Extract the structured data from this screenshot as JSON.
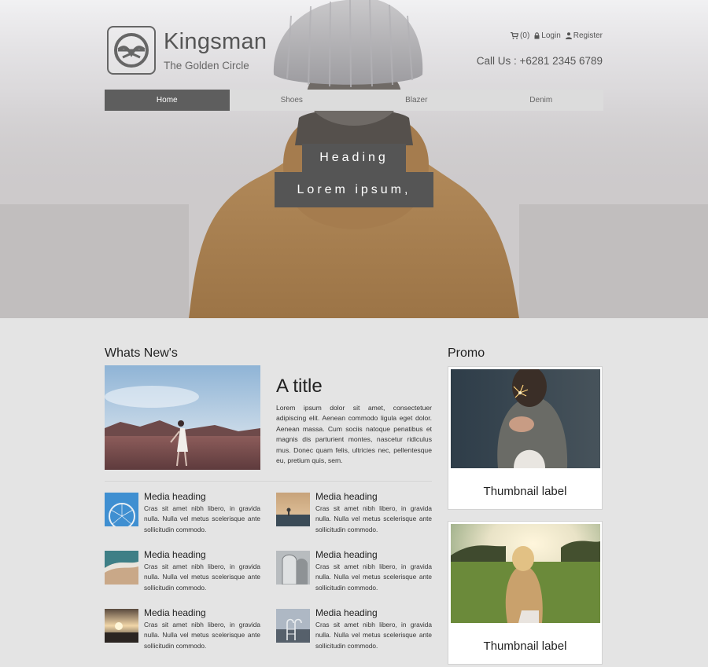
{
  "brand": {
    "title": "Kingsman",
    "subtitle": "The Golden Circle"
  },
  "top_links": {
    "cart": "(0)",
    "login": "Login",
    "register": "Register"
  },
  "contact": {
    "call": "Call Us : +6281 2345 6789"
  },
  "nav": {
    "items": [
      {
        "label": "Home",
        "active": true
      },
      {
        "label": "Shoes",
        "active": false
      },
      {
        "label": "Blazer",
        "active": false
      },
      {
        "label": "Denim",
        "active": false
      }
    ]
  },
  "hero": {
    "heading": "Heading",
    "text": "Lorem ipsum,"
  },
  "whats_new": {
    "title": "Whats New's",
    "feature": {
      "title": "A title",
      "body": "Lorem ipsum dolor sit amet, consectetuer adipiscing elit. Aenean commodo ligula eget dolor. Aenean massa. Cum sociis natoque penatibus et magnis dis parturient montes, nascetur ridiculus mus. Donec quam felis, ultricies nec, pellentesque eu, pretium quis, sem."
    },
    "media": [
      {
        "heading": "Media heading",
        "body": "Cras sit amet nibh libero, in gravida nulla. Nulla vel metus scelerisque ante sollicitudin commodo."
      },
      {
        "heading": "Media heading",
        "body": "Cras sit amet nibh libero, in gravida nulla. Nulla vel metus scelerisque ante sollicitudin commodo."
      },
      {
        "heading": "Media heading",
        "body": "Cras sit amet nibh libero, in gravida nulla. Nulla vel metus scelerisque ante sollicitudin commodo."
      },
      {
        "heading": "Media heading",
        "body": "Cras sit amet nibh libero, in gravida nulla. Nulla vel metus scelerisque ante sollicitudin commodo."
      },
      {
        "heading": "Media heading",
        "body": "Cras sit amet nibh libero, in gravida nulla. Nulla vel metus scelerisque ante sollicitudin commodo."
      },
      {
        "heading": "Media heading",
        "body": "Cras sit amet nibh libero, in gravida nulla. Nulla vel metus scelerisque ante sollicitudin commodo."
      }
    ]
  },
  "promo": {
    "title": "Promo",
    "thumbnails": [
      {
        "label": "Thumbnail label"
      },
      {
        "label": "Thumbnail label"
      }
    ]
  },
  "icons": {
    "logo": "kingsman-logo-icon",
    "cart": "shopping-cart-icon",
    "login": "lock-icon",
    "register": "user-icon"
  },
  "colors": {
    "nav_active": "#5e5e5e",
    "nav_bg": "#dcdcdc",
    "caption_bg": "#555555",
    "page_bg": "#e4e4e4"
  }
}
